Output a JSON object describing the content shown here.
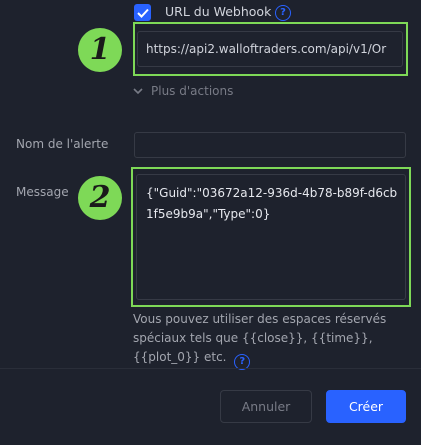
{
  "webhook": {
    "checkbox_label": "URL du Webhook",
    "url_value": "https://api2.walloftraders.com/api/v1/Or",
    "more_actions_label": "Plus d'actions"
  },
  "badges": {
    "first": "1",
    "second": "2"
  },
  "alert_name": {
    "label": "Nom de l'alerte",
    "value": ""
  },
  "message": {
    "label": "Message",
    "value": "{\"Guid\":\"03672a12-936d-4b78-b89f-d6cb1f5e9b9a\",\"Type\":0}",
    "hint": "Vous pouvez utiliser des espaces réservés spéciaux tels que {{close}}, {{time}}, {{plot_0}} etc."
  },
  "buttons": {
    "cancel": "Annuler",
    "create": "Créer"
  },
  "colors": {
    "accent": "#2962ff",
    "highlight": "#7ed957",
    "background": "#1e222d"
  },
  "icons": {
    "checkbox": "check-icon",
    "help": "help-icon",
    "expand": "chevron-down-icon"
  }
}
